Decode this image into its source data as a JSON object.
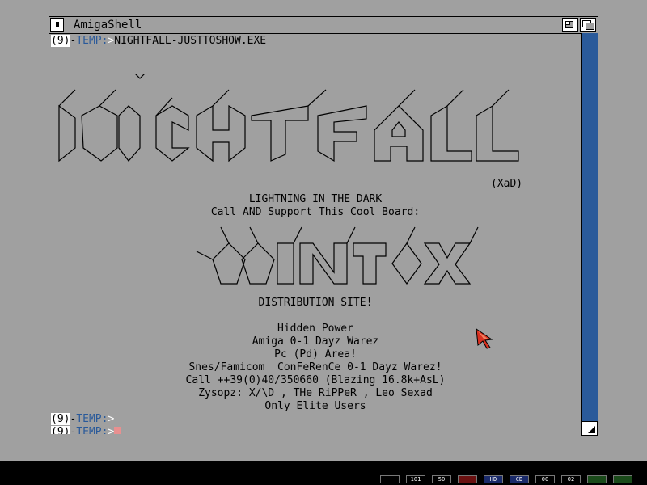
{
  "window": {
    "title": "AmigaShell",
    "command_line": {
      "prompt_num": "(9)",
      "sep": "-",
      "dir": "TEMP:",
      "arrow": ">",
      "command": "NIGHTFALL-JUSTTOSHOW.EXE"
    },
    "prompt_lines": [
      {
        "prompt_num": "(9)",
        "sep": "-",
        "dir": "TEMP:",
        "arrow": ">"
      },
      {
        "prompt_num": "(9)",
        "sep": "-",
        "dir": "TEMP:",
        "arrow": ">"
      }
    ]
  },
  "output": {
    "logo_tag": "(XaD)",
    "tagline": "LIGHTNING IN THE DARK",
    "support_line": "Call AND Support This Cool Board:",
    "distribution": "DISTRIBUTION SITE!",
    "lines": [
      "Hidden Power",
      "Amiga 0-1 Dayz Warez",
      "Pc (Pd) Area!",
      "Snes/Famicom  ConFeRenCe 0-1 Dayz Warez!",
      "Call ++39(0)40/350660 (Blazing 16.8k+AsL)",
      "Zysopz: X/\\D , THe RiPPeR , Leo Sexad",
      "Only Elite Users"
    ]
  },
  "statusbar": {
    "leds": [
      "",
      "101",
      "50",
      "",
      "HD",
      "CD",
      "00",
      "02",
      "",
      ""
    ]
  },
  "colors": {
    "background": "#a0a0a0",
    "accent": "#2a5a9a",
    "cursor": "#e89090"
  }
}
